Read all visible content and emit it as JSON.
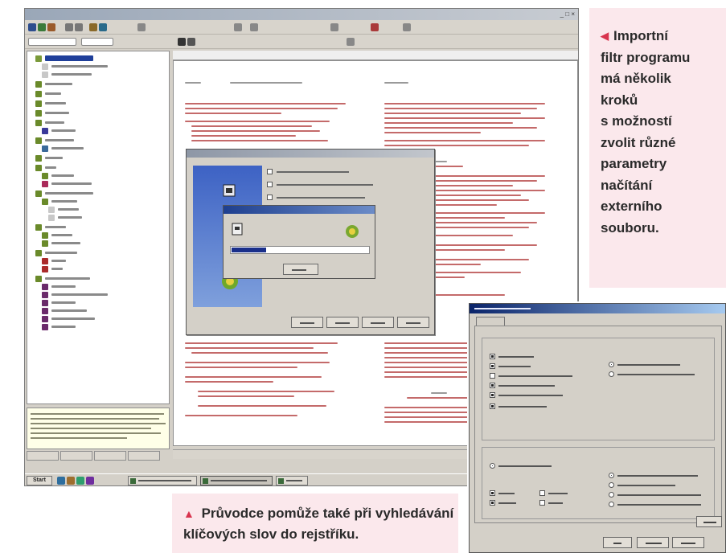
{
  "caption_right": {
    "arrow": "◀",
    "lines": [
      "Importní",
      "filtr programu",
      "má několik",
      "kroků",
      "s možností",
      "zvolit různé",
      "parametry",
      "načítání",
      "externího",
      "souboru."
    ]
  },
  "caption_bottom": {
    "arrow": "▲",
    "lines": [
      "Průvodce pomůže také při vyhledávání",
      "klíčových slov do rejstříku."
    ]
  },
  "screenshot": {
    "start_label": "Start",
    "tabs": [
      "",
      "",
      "",
      ""
    ],
    "progress_fraction": 0.25
  },
  "colors": {
    "caption_bg": "#fbe8ec",
    "caption_arrow": "#d8344e",
    "caption_text": "#2a2a2a",
    "doc_text": "#c46a6a",
    "dialog_title": "#0a246a"
  },
  "icons": [
    "arrow-left-icon",
    "arrow-up-icon",
    "folder-icon",
    "book-icon",
    "globe-icon",
    "computer-icon"
  ]
}
